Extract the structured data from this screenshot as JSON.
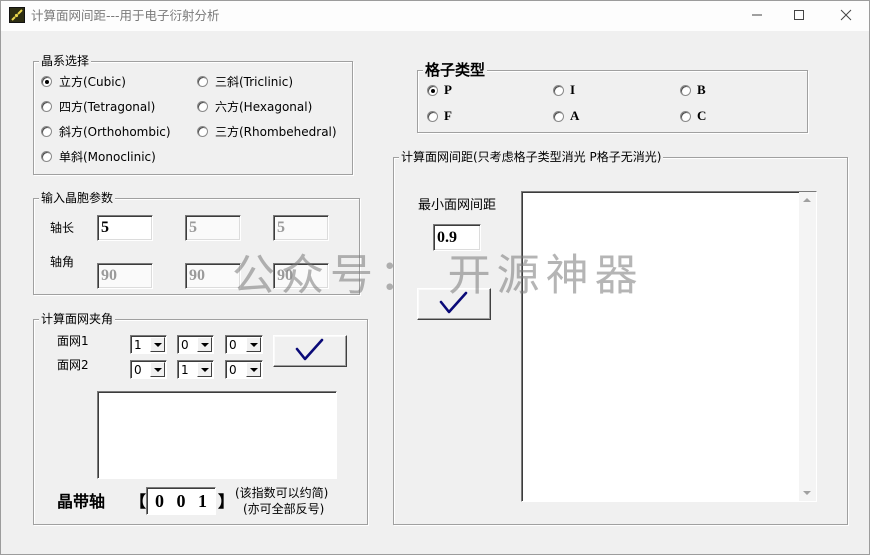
{
  "window": {
    "title": "计算面网间距---用于电子衍射分析",
    "icons": {
      "app": "app-icon",
      "minimize": "minimize-icon",
      "maximize": "maximize-icon",
      "close": "close-icon"
    }
  },
  "crystal_system": {
    "title": "晶系选择",
    "options": [
      {
        "label": "立方(Cubic)",
        "checked": true
      },
      {
        "label": "三斜(Triclinic)",
        "checked": false
      },
      {
        "label": "四方(Tetragonal)",
        "checked": false
      },
      {
        "label": "六方(Hexagonal)",
        "checked": false
      },
      {
        "label": "斜方(Orthohombic)",
        "checked": false
      },
      {
        "label": "三方(Rhombehedral)",
        "checked": false
      },
      {
        "label": "单斜(Monoclinic)",
        "checked": false
      }
    ]
  },
  "cell_params": {
    "title": "输入晶胞参数",
    "length_label": "轴长",
    "lengths": [
      {
        "value": "5",
        "enabled": true
      },
      {
        "value": "5",
        "enabled": false
      },
      {
        "value": "5",
        "enabled": false
      }
    ],
    "angle_label": "轴角",
    "angles": [
      {
        "value": "90",
        "enabled": false
      },
      {
        "value": "90",
        "enabled": false
      },
      {
        "value": "90",
        "enabled": false
      }
    ]
  },
  "interplanar_angle": {
    "title": "计算面网夹角",
    "plane1_label": "面网1",
    "plane1": [
      "1",
      "0",
      "0"
    ],
    "plane2_label": "面网2",
    "plane2": [
      "0",
      "1",
      "0"
    ],
    "calc_button_icon": "checkmark-icon",
    "result": "",
    "zone_axis_label": "晶带轴",
    "bracket_open": "【",
    "zone_axis": "0 0 1",
    "bracket_close": "】",
    "note_reducible": "(该指数可以约简)",
    "note_reversible": "(亦可全部反号)"
  },
  "lattice_type": {
    "title": "格子类型",
    "options": [
      {
        "label": "P",
        "checked": true
      },
      {
        "label": "I",
        "checked": false
      },
      {
        "label": "B",
        "checked": false
      },
      {
        "label": "F",
        "checked": false
      },
      {
        "label": "A",
        "checked": false
      },
      {
        "label": "C",
        "checked": false
      }
    ]
  },
  "interplanar_spacing": {
    "title": "计算面网间距(只考虑格子类型消光 P格子无消光)",
    "min_spacing_label": "最小面网间距",
    "min_spacing": "0.9",
    "calc_button_icon": "checkmark-icon",
    "result": ""
  },
  "watermark": "公众号： 开源神器",
  "colors": {
    "background": "#f0f0f0",
    "checkmark": "#0a0a78"
  }
}
